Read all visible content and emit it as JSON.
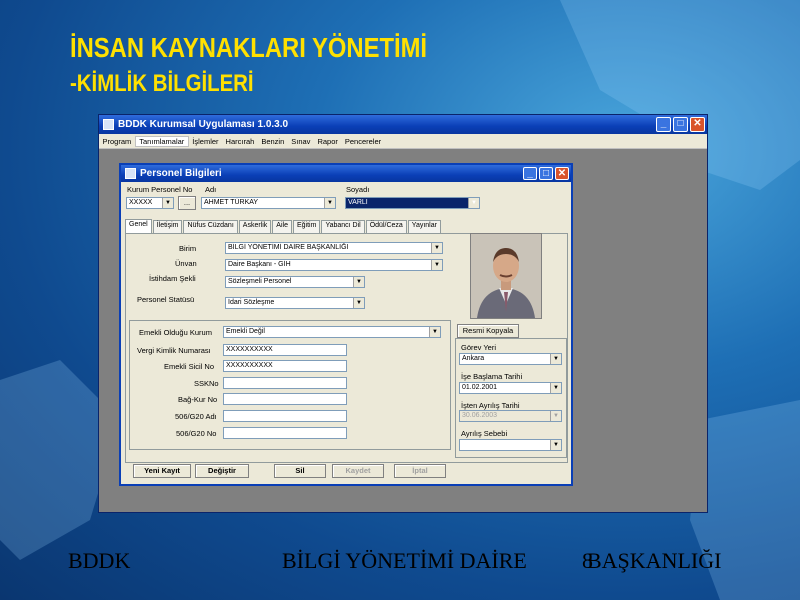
{
  "slide": {
    "title_line1": "İNSAN KAYNAKLARI YÖNETİMİ",
    "title_line2": "-KİMLİK BİLGİLERİ",
    "footer_left": "BDDK",
    "footer_center": "BİLGİ YÖNETİMİ DAİRE",
    "footer_page": "8",
    "footer_right": "BAŞKANLIĞI",
    "colors": {
      "title": "#ffe000",
      "background": "#1e6fb5"
    }
  },
  "main_window": {
    "title": "BDDK Kurumsal Uygulaması 1.0.3.0",
    "menu": [
      "Program",
      "Tanımlamalar",
      "İşlemler",
      "Harcırah",
      "Benzin",
      "Sınav",
      "Rapor",
      "Pencereler"
    ]
  },
  "dialog": {
    "title": "Personel Bilgileri",
    "labels": {
      "kurum_no": "Kurum Personel No",
      "adi": "Adı",
      "soyadi": "Soyadı"
    },
    "kurum_no_value": "XXXXX",
    "lookup_button": "...",
    "adi_value": "AHMET TÜRKAY",
    "soyadi_value": "VARLI",
    "tabs": [
      "Genel",
      "İletişim",
      "Nüfus Cüzdanı",
      "Askerlik",
      "Aile",
      "Eğitim",
      "Yabancı Dil",
      "Ödül/Ceza",
      "Yayınlar"
    ],
    "active_tab": "Genel",
    "genel": {
      "birim_label": "Birim",
      "birim_value": "BİLGİ YÖNETİMİ DAİRE BAŞKANLIĞI",
      "unvan_label": "Ünvan",
      "unvan_value": "Daire Başkanı - GİH",
      "istihdam_label": "İstihdam Şekli",
      "istihdam_value": "Sözleşmeli Personel",
      "statu_label": "Personel Statüsü",
      "statu_value": "İdari Sözleşme"
    },
    "photo_button": "Resmi Kopyala",
    "emekli": {
      "kurum_label": "Emekli Olduğu Kurum",
      "kurum_value": "Emekli Değil",
      "vergi_label": "Vergi Kimlik Numarası",
      "vergi_value": "XXXXXXXXXX",
      "sicil_label": "Emekli Sicil No",
      "sicil_value": "XXXXXXXXXX",
      "ssk_label": "SSKNo",
      "bagkur_label": "Bağ-Kur No",
      "g20_adi_label": "506/G20 Adı",
      "g20_no_label": "506/G20 No"
    },
    "gorev": {
      "yeri_label": "Görev Yeri",
      "yeri_value": "Ankara",
      "baslama_label": "İşe Başlama Tarihi",
      "baslama_value": "01.02.2001",
      "ayrilis_label": "İşten Ayrılış Tarihi",
      "ayrilis_value": "30.06.2003",
      "sebep_label": "Ayrılış Sebebi"
    },
    "buttons": {
      "yeni": "Yeni Kayıt",
      "degistir": "Değiştir",
      "sil": "Sil",
      "kaydet": "Kaydet",
      "iptal": "İptal"
    }
  }
}
